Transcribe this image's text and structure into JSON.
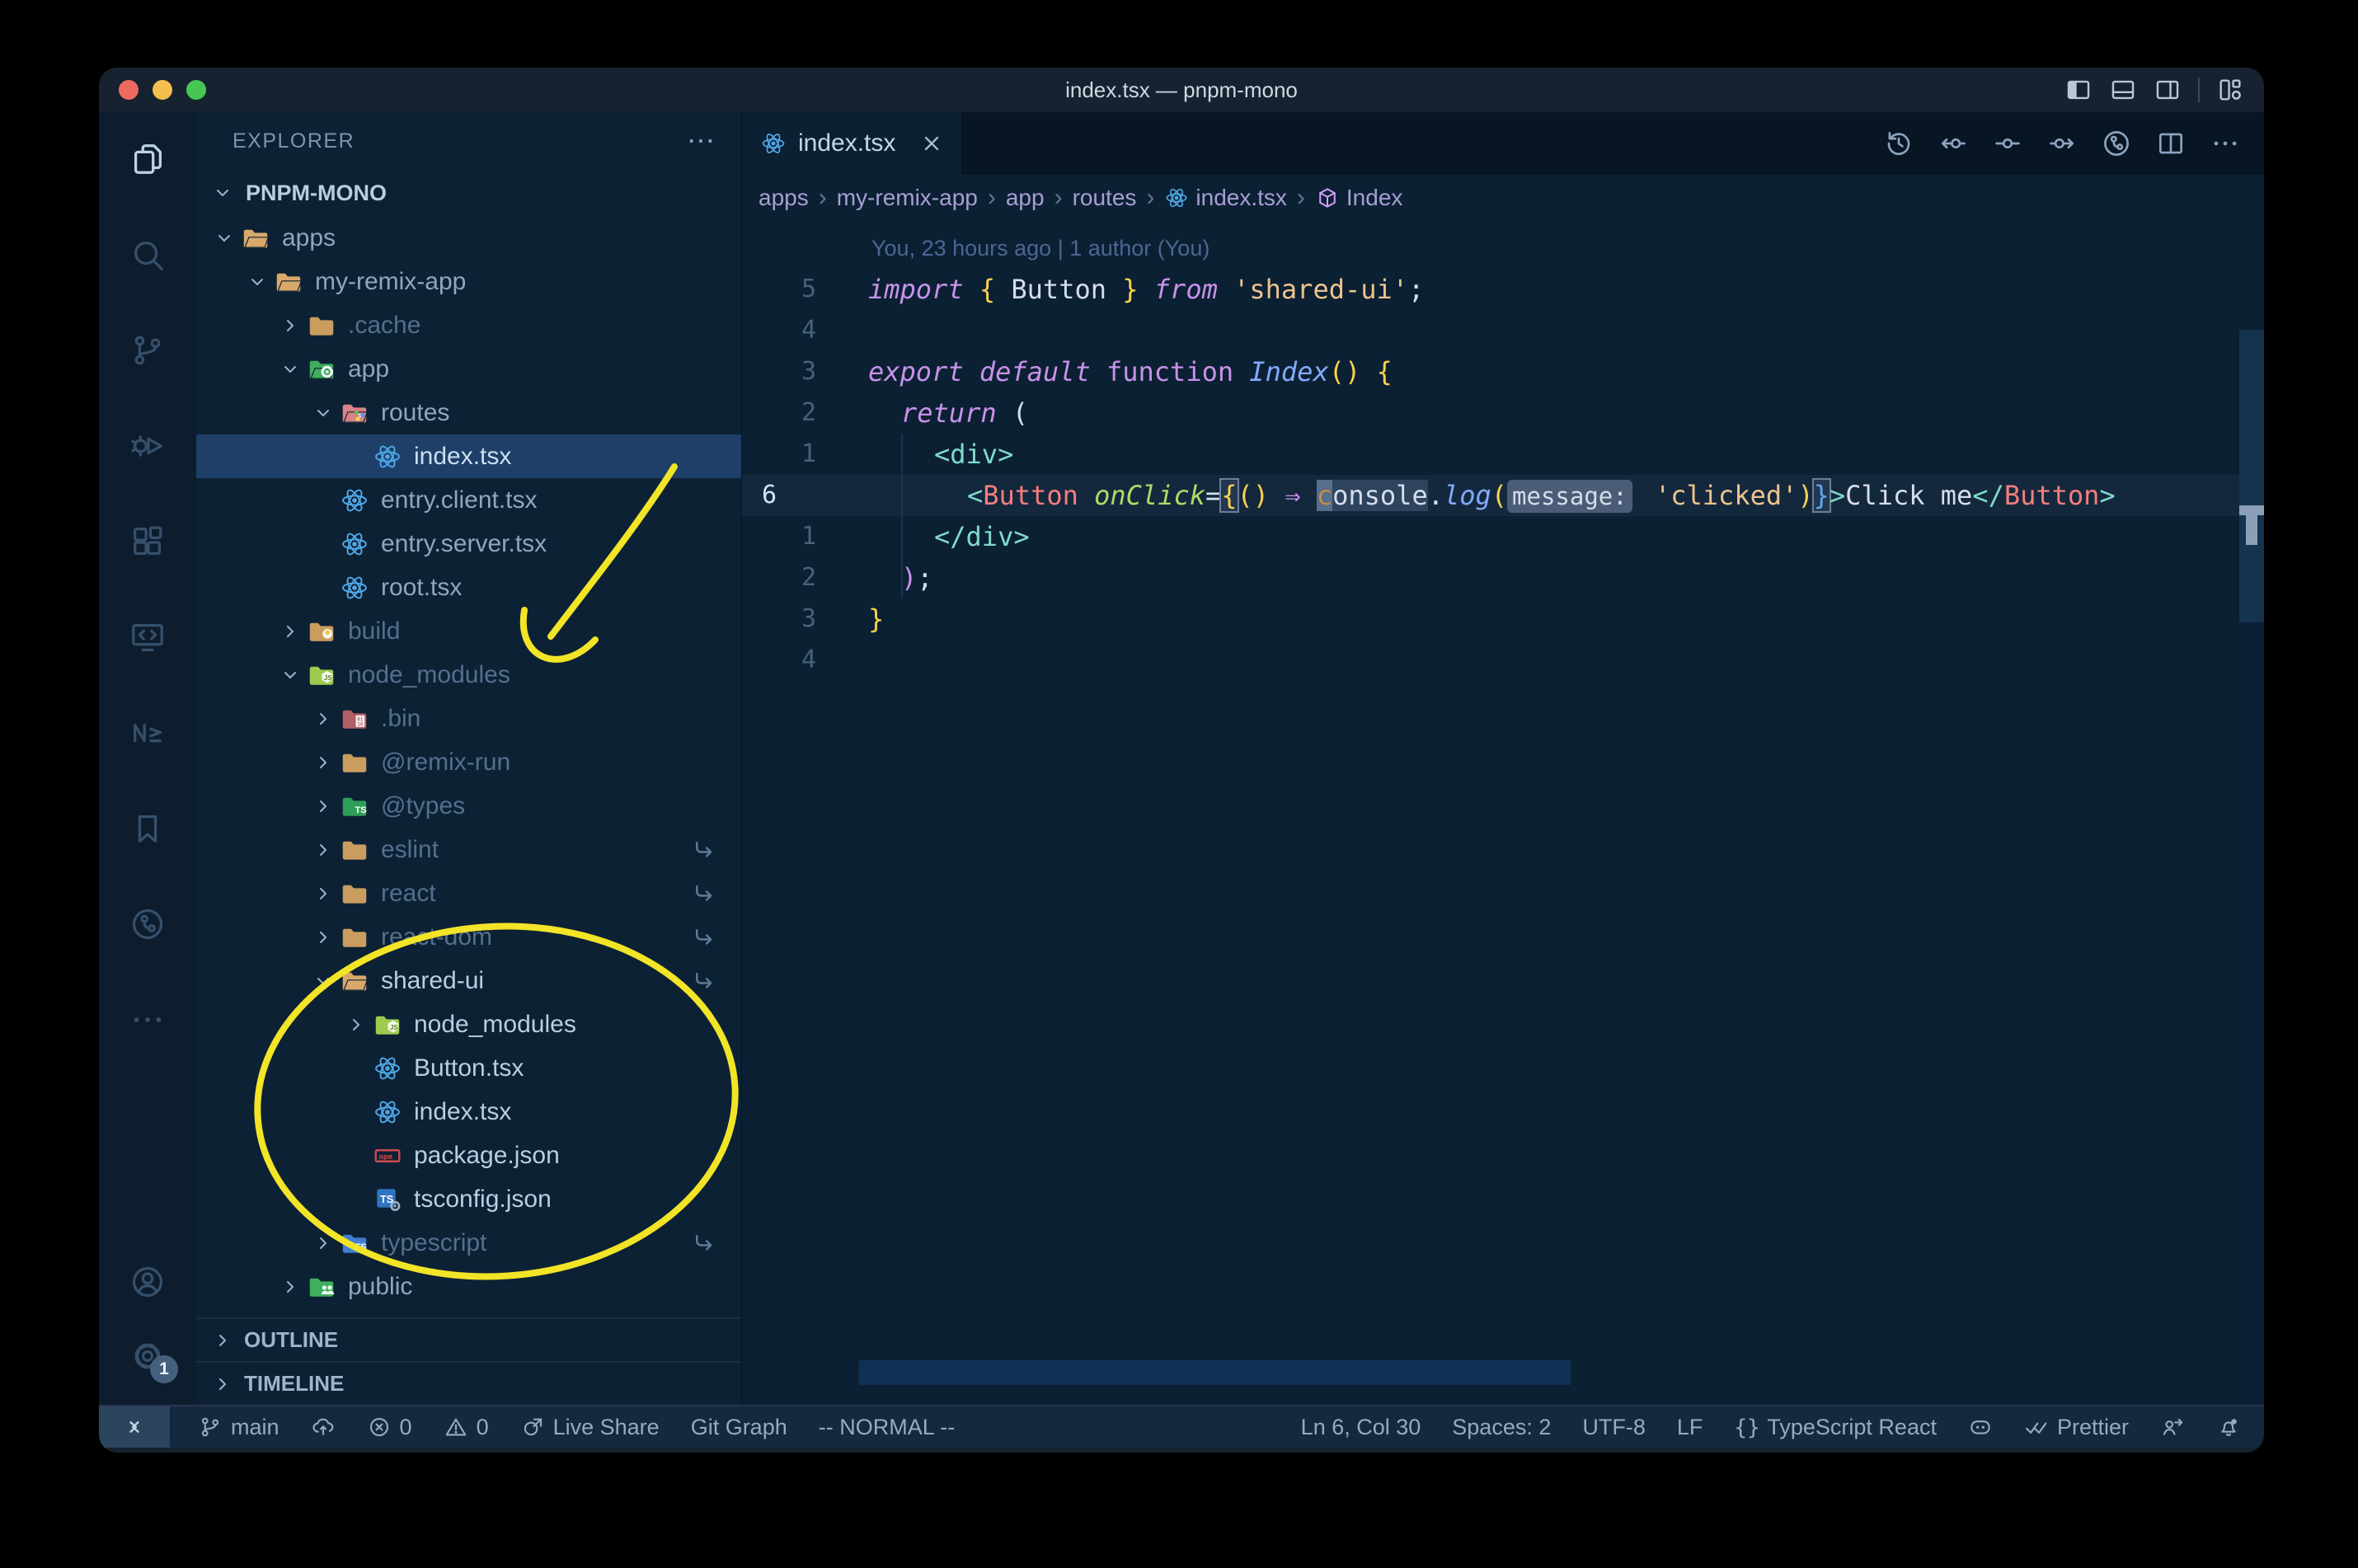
{
  "window": {
    "title": "index.tsx — pnpm-mono",
    "controls": [
      {
        "name": "close-window-button",
        "color": "#ee6a5f"
      },
      {
        "name": "minimize-window-button",
        "color": "#f4bf4f"
      },
      {
        "name": "zoom-window-button",
        "color": "#47c654"
      }
    ],
    "layout_toggles": [
      {
        "name": "toggle-primary-sidebar",
        "icon": "layout-sidebar-left-filled"
      },
      {
        "name": "toggle-panel",
        "icon": "layout-panel-bottom"
      },
      {
        "name": "toggle-secondary-sidebar",
        "icon": "layout-sidebar-right"
      },
      {
        "name": "customize-layout",
        "icon": "layout-customize"
      }
    ]
  },
  "activity_bar": {
    "top": [
      {
        "name": "explorer",
        "icon": "files-icon",
        "active": true
      },
      {
        "name": "search",
        "icon": "search-icon",
        "active": false
      },
      {
        "name": "source-control",
        "icon": "branch-icon",
        "active": false
      },
      {
        "name": "run-and-debug",
        "icon": "debug-icon",
        "active": false
      },
      {
        "name": "extensions",
        "icon": "extensions-icon",
        "active": false
      },
      {
        "name": "remote-explorer",
        "icon": "remote-icon",
        "active": false
      },
      {
        "name": "nx-console",
        "icon": "nx-icon",
        "active": false
      },
      {
        "name": "bookmarks",
        "icon": "bookmark-icon",
        "active": false
      },
      {
        "name": "git-graph",
        "icon": "gitgraph-icon",
        "active": false
      },
      {
        "name": "more-views",
        "icon": "ellipsis-icon",
        "active": false
      }
    ],
    "bottom": [
      {
        "name": "accounts",
        "icon": "account-icon"
      },
      {
        "name": "settings",
        "icon": "gear-icon",
        "badge": "1"
      }
    ]
  },
  "sidebar": {
    "header": "EXPLORER",
    "header_more": "⋯",
    "section": "PNPM-MONO",
    "outline": "OUTLINE",
    "timeline": "TIMELINE",
    "tree": [
      {
        "label": "apps",
        "depth": 0,
        "expand": "open",
        "icon": "folder-open-tan",
        "tone": "normal"
      },
      {
        "label": "my-remix-app",
        "depth": 1,
        "expand": "open",
        "icon": "folder-open-tan",
        "tone": "normal"
      },
      {
        "label": ".cache",
        "depth": 2,
        "expand": "closed",
        "icon": "folder-cache",
        "tone": "dim"
      },
      {
        "label": "app",
        "depth": 2,
        "expand": "open",
        "icon": "folder-app",
        "tone": "normal"
      },
      {
        "label": "routes",
        "depth": 3,
        "expand": "open",
        "icon": "folder-routes",
        "tone": "normal"
      },
      {
        "label": "index.tsx",
        "depth": 4,
        "expand": "none",
        "icon": "react-file",
        "tone": "normal",
        "selected": true
      },
      {
        "label": "entry.client.tsx",
        "depth": 3,
        "expand": "none",
        "icon": "react-file",
        "tone": "normal"
      },
      {
        "label": "entry.server.tsx",
        "depth": 3,
        "expand": "none",
        "icon": "react-file",
        "tone": "normal"
      },
      {
        "label": "root.tsx",
        "depth": 3,
        "expand": "none",
        "icon": "react-file",
        "tone": "normal"
      },
      {
        "label": "build",
        "depth": 2,
        "expand": "closed",
        "icon": "folder-build",
        "tone": "dim"
      },
      {
        "label": "node_modules",
        "depth": 2,
        "expand": "open",
        "icon": "folder-nm",
        "tone": "dim"
      },
      {
        "label": ".bin",
        "depth": 3,
        "expand": "closed",
        "icon": "folder-bin",
        "tone": "dim"
      },
      {
        "label": "@remix-run",
        "depth": 3,
        "expand": "closed",
        "icon": "folder-tan",
        "tone": "dim"
      },
      {
        "label": "@types",
        "depth": 3,
        "expand": "closed",
        "icon": "folder-types",
        "tone": "dim"
      },
      {
        "label": "eslint",
        "depth": 3,
        "expand": "closed",
        "icon": "folder-tan",
        "tone": "dim",
        "symlink": true
      },
      {
        "label": "react",
        "depth": 3,
        "expand": "closed",
        "icon": "folder-tan",
        "tone": "dim",
        "symlink": true
      },
      {
        "label": "react-dom",
        "depth": 3,
        "expand": "closed",
        "icon": "folder-tan",
        "tone": "dim",
        "symlink": true
      },
      {
        "label": "shared-ui",
        "depth": 3,
        "expand": "open",
        "icon": "folder-open-tan",
        "tone": "bright",
        "symlink": true
      },
      {
        "label": "node_modules",
        "depth": 4,
        "expand": "closed",
        "icon": "folder-nm",
        "tone": "bright"
      },
      {
        "label": "Button.tsx",
        "depth": 4,
        "expand": "none",
        "icon": "react-file",
        "tone": "bright"
      },
      {
        "label": "index.tsx",
        "depth": 4,
        "expand": "none",
        "icon": "react-file",
        "tone": "bright"
      },
      {
        "label": "package.json",
        "depth": 4,
        "expand": "none",
        "icon": "npm-file",
        "tone": "bright"
      },
      {
        "label": "tsconfig.json",
        "depth": 4,
        "expand": "none",
        "icon": "tsconfig-file",
        "tone": "bright"
      },
      {
        "label": "typescript",
        "depth": 3,
        "expand": "closed",
        "icon": "folder-ts",
        "tone": "dim",
        "symlink": true
      },
      {
        "label": "public",
        "depth": 2,
        "expand": "closed",
        "icon": "folder-public",
        "tone": "normal"
      }
    ]
  },
  "tabs": {
    "items": [
      {
        "label": "index.tsx",
        "icon": "react-file",
        "active": true
      }
    ],
    "actions": [
      {
        "name": "timeline-history",
        "icon": "history-icon"
      },
      {
        "name": "previous-change",
        "icon": "prev-change-icon"
      },
      {
        "name": "gitlens-change",
        "icon": "change-icon"
      },
      {
        "name": "next-change",
        "icon": "next-change-icon"
      },
      {
        "name": "open-git-graph",
        "icon": "gitgraph-icon"
      },
      {
        "name": "split-editor",
        "icon": "split-icon"
      },
      {
        "name": "more-actions",
        "icon": "ellipsis-icon"
      }
    ]
  },
  "breadcrumbs": {
    "items": [
      {
        "label": "apps"
      },
      {
        "label": "my-remix-app"
      },
      {
        "label": "app"
      },
      {
        "label": "routes"
      },
      {
        "label": "index.tsx",
        "icon": "react-file"
      },
      {
        "label": "Index",
        "icon": "symbol-cube"
      }
    ]
  },
  "editor": {
    "blame": "You, 23 hours ago | 1 author (You)",
    "lines": [
      {
        "num": "5",
        "indent": 0,
        "segs": [
          {
            "t": "import",
            "c": "kwi"
          },
          {
            "t": " ",
            "c": "pl"
          },
          {
            "t": "{",
            "c": "brace"
          },
          {
            "t": " ",
            "c": "pl"
          },
          {
            "t": "Button",
            "c": "var"
          },
          {
            "t": " ",
            "c": "pl"
          },
          {
            "t": "}",
            "c": "brace"
          },
          {
            "t": " ",
            "c": "pl"
          },
          {
            "t": "from",
            "c": "kwi"
          },
          {
            "t": " ",
            "c": "pl"
          },
          {
            "t": "'shared-ui'",
            "c": "str"
          },
          {
            "t": ";",
            "c": "pl"
          }
        ]
      },
      {
        "num": "4",
        "indent": 0,
        "segs": []
      },
      {
        "num": "3",
        "indent": 0,
        "segs": [
          {
            "t": "export",
            "c": "kwi"
          },
          {
            "t": " ",
            "c": "pl"
          },
          {
            "t": "default",
            "c": "kwi"
          },
          {
            "t": " ",
            "c": "pl"
          },
          {
            "t": "function",
            "c": "kw"
          },
          {
            "t": " ",
            "c": "pl"
          },
          {
            "t": "Index",
            "c": "fni"
          },
          {
            "t": "()",
            "c": "brace"
          },
          {
            "t": " ",
            "c": "pl"
          },
          {
            "t": "{",
            "c": "brace"
          }
        ]
      },
      {
        "num": "2",
        "indent": 1,
        "segs": [
          {
            "t": "return",
            "c": "kwi"
          },
          {
            "t": " ",
            "c": "pl"
          },
          {
            "t": "(",
            "c": "pl"
          }
        ]
      },
      {
        "num": "1",
        "indent": 2,
        "segs": [
          {
            "t": "<",
            "c": "tagp"
          },
          {
            "t": "div",
            "c": "tag"
          },
          {
            "t": ">",
            "c": "tagp"
          }
        ]
      },
      {
        "num": "6",
        "indent": 3,
        "active": true,
        "segs": [
          {
            "t": "<",
            "c": "tagp"
          },
          {
            "t": "Button",
            "c": "comp"
          },
          {
            "t": " ",
            "c": "pl"
          },
          {
            "t": "onClick",
            "c": "attri"
          },
          {
            "t": "=",
            "c": "pl"
          },
          {
            "t": "{",
            "c": "brace",
            "box": true
          },
          {
            "t": "()",
            "c": "brace"
          },
          {
            "t": " ",
            "c": "pl"
          },
          {
            "t": "⇒",
            "c": "kw"
          },
          {
            "t": " ",
            "c": "pl"
          },
          {
            "t": "c",
            "c": "cur",
            "cursor": true
          },
          {
            "t": "onsole",
            "c": "var",
            "hl": true
          },
          {
            "t": ".",
            "c": "pl"
          },
          {
            "t": "log",
            "c": "fni"
          },
          {
            "t": "(",
            "c": "brace"
          },
          {
            "t": "message:",
            "c": "pl",
            "inlay": true
          },
          {
            "t": " ",
            "c": "pl"
          },
          {
            "t": "'clicked'",
            "c": "str"
          },
          {
            "t": ")",
            "c": "brace"
          },
          {
            "t": "}",
            "c": "braceblue",
            "box": true
          },
          {
            "t": ">",
            "c": "tagp"
          },
          {
            "t": "Click me",
            "c": "pl"
          },
          {
            "t": "</",
            "c": "tagp"
          },
          {
            "t": "Button",
            "c": "comp"
          },
          {
            "t": ">",
            "c": "tagp"
          }
        ]
      },
      {
        "num": "1",
        "indent": 2,
        "segs": [
          {
            "t": "</",
            "c": "tagp"
          },
          {
            "t": "div",
            "c": "tag"
          },
          {
            "t": ">",
            "c": "tagp"
          }
        ]
      },
      {
        "num": "2",
        "indent": 1,
        "segs": [
          {
            "t": ")",
            "c": "kw"
          },
          {
            "t": ";",
            "c": "pl"
          }
        ]
      },
      {
        "num": "3",
        "indent": 0,
        "segs": [
          {
            "t": "}",
            "c": "brace"
          }
        ]
      },
      {
        "num": "4",
        "indent": 0,
        "segs": []
      }
    ]
  },
  "status_bar": {
    "left": [
      {
        "name": "remote-indicator",
        "icon": "remote-status-icon",
        "label": "",
        "box": true
      },
      {
        "name": "branch",
        "icon": "branch-icon",
        "label": "main"
      },
      {
        "name": "sync",
        "icon": "cloud-upload-icon",
        "label": ""
      },
      {
        "name": "problems-errors",
        "icon": "error-icon",
        "label": "0"
      },
      {
        "name": "problems-warnings",
        "icon": "warning-icon",
        "label": "0"
      },
      {
        "name": "live-share",
        "icon": "liveshare-icon",
        "label": "Live Share"
      },
      {
        "name": "git-graph",
        "label": "Git Graph"
      },
      {
        "name": "vim-mode",
        "label": "-- NORMAL --"
      }
    ],
    "right": [
      {
        "name": "cursor-position",
        "label": "Ln 6, Col 30"
      },
      {
        "name": "indentation",
        "label": "Spaces: 2"
      },
      {
        "name": "encoding",
        "label": "UTF-8"
      },
      {
        "name": "eol",
        "label": "LF"
      },
      {
        "name": "language-mode",
        "icon": "braces-glyph",
        "label": "TypeScript React"
      },
      {
        "name": "copilot",
        "icon": "copilot-icon",
        "label": ""
      },
      {
        "name": "formatter",
        "icon": "double-check-icon",
        "label": "Prettier"
      },
      {
        "name": "feedback",
        "icon": "feedback-icon",
        "label": ""
      },
      {
        "name": "notifications",
        "icon": "bell-icon",
        "label": ""
      }
    ]
  },
  "annotations": {
    "color": "#f2e427",
    "shapes": [
      "hand-drawn-arrow-to-node-modules",
      "hand-drawn-ellipse-around-shared-ui"
    ]
  }
}
